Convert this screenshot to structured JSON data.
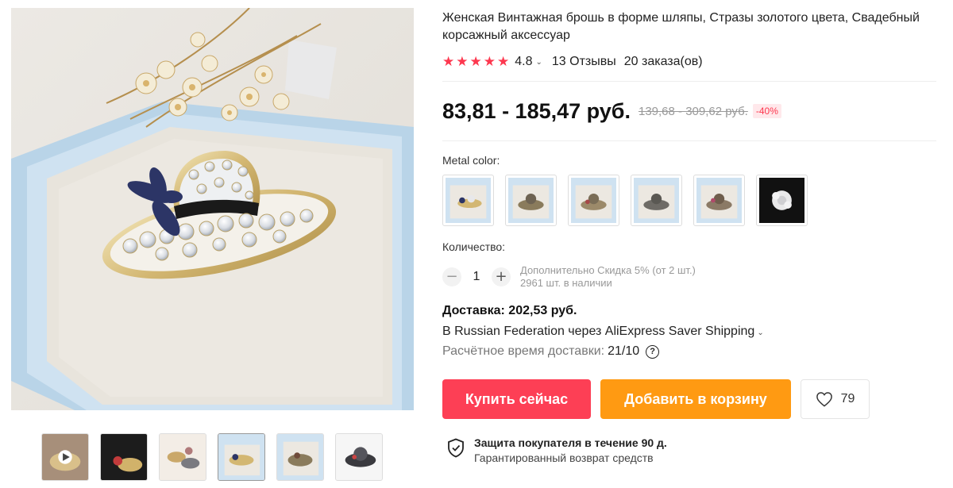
{
  "product": {
    "title": "Женская Винтажная брошь в форме шляпы, Стразы золотого цвета, Свадебный корсажный аксессуар",
    "rating": "4.8",
    "rating_stars": 5,
    "reviews": "13 Отзывы",
    "orders": "20 заказа(ов)"
  },
  "price": {
    "current": "83,81 - 185,47 руб.",
    "old": "139,68 - 309,62 руб.",
    "discount": "-40%"
  },
  "variants": {
    "label": "Metal color:",
    "options": [
      "swatch-1",
      "swatch-2",
      "swatch-3",
      "swatch-4",
      "swatch-5",
      "swatch-6"
    ]
  },
  "quantity": {
    "label": "Количество:",
    "value": "1",
    "minus": "−",
    "plus": "+",
    "discount_note": "Дополнительно Скидка 5% (от 2 шт.)",
    "stock": "2961 шт. в наличии"
  },
  "delivery": {
    "price": "Доставка: 202,53 руб.",
    "route": "В Russian Federation через AliExpress Saver Shipping",
    "time_label": "Расчётное время доставки:",
    "time_value": "21/10",
    "help": "?"
  },
  "actions": {
    "buy": "Купить сейчас",
    "cart": "Добавить в корзину",
    "wishlist_count": "79"
  },
  "protection": {
    "title": "Защита покупателя в течение 90 д.",
    "subtitle": "Гарантированный возврат средств"
  },
  "colors": {
    "accent_red": "#fd3f55",
    "accent_orange": "#ff9a12",
    "star": "#fd384f"
  },
  "icons": [
    "star-icon",
    "chevron-down-icon",
    "question-icon",
    "heart-icon",
    "shield-check-icon"
  ]
}
